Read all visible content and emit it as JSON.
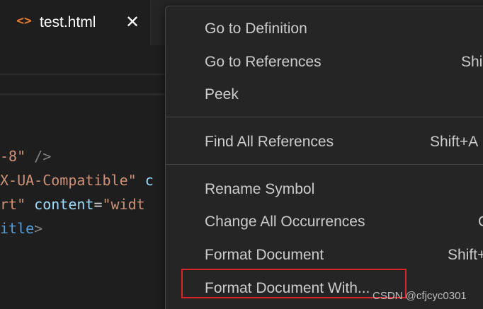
{
  "tab": {
    "icon": "<>",
    "label": "test.html",
    "close_glyph": "✕"
  },
  "code_lines": [
    [
      {
        "t": "-8\"",
        "c": "c-str"
      },
      {
        "t": " />",
        "c": "c-punc"
      }
    ],
    [
      {
        "t": "X-UA-Compatible\"",
        "c": "c-str"
      },
      {
        "t": " c",
        "c": "c-attr"
      }
    ],
    [
      {
        "t": "rt\"",
        "c": "c-str"
      },
      {
        "t": " content",
        "c": "c-attr"
      },
      {
        "t": "=",
        "c": "c-eq"
      },
      {
        "t": "\"widt",
        "c": "c-str"
      }
    ],
    [
      {
        "t": "itle",
        "c": "c-tag"
      },
      {
        "t": ">",
        "c": "c-punc"
      }
    ]
  ],
  "menu": {
    "groups": [
      [
        {
          "label": "Go to Definition",
          "shortcut": ""
        },
        {
          "label": "Go to References",
          "shortcut": "Shi"
        },
        {
          "label": "Peek",
          "shortcut": ""
        }
      ],
      [
        {
          "label": "Find All References",
          "shortcut": "Shift+A"
        }
      ],
      [
        {
          "label": "Rename Symbol",
          "shortcut": ""
        },
        {
          "label": "Change All Occurrences",
          "shortcut": "C"
        },
        {
          "label": "Format Document",
          "shortcut": "Shift+"
        },
        {
          "label": "Format Document With...",
          "shortcut": ""
        }
      ]
    ]
  },
  "watermark": "CSDN @cfjcyc0301",
  "colors": {
    "accent_highlight": "#d9262b",
    "menu_bg": "#252526",
    "editor_bg": "#1e1e1e",
    "html_icon": "#e37933"
  }
}
